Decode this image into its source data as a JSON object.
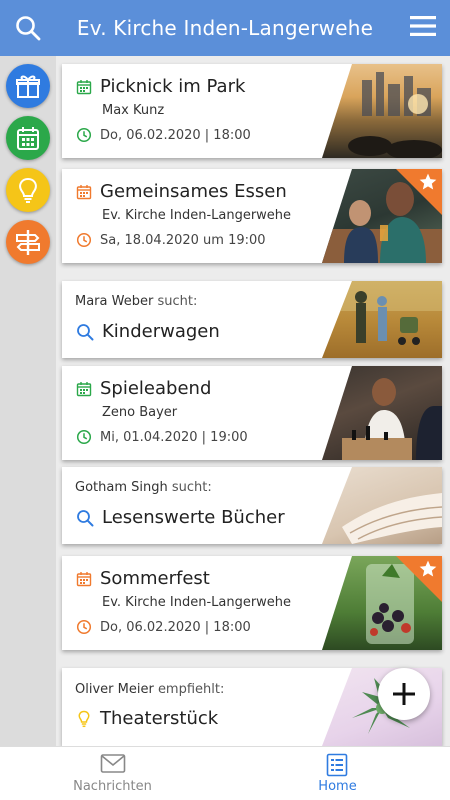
{
  "header": {
    "title": "Ev. Kirche Inden-Langerwehe",
    "search_icon": "search-icon",
    "menu_icon": "hamburger-menu-icon",
    "color": "#5b8fd9"
  },
  "rail": {
    "items": [
      {
        "icon": "gift-icon",
        "color": "#2f7be0"
      },
      {
        "icon": "calendar-icon",
        "color": "#2ba84a"
      },
      {
        "icon": "lightbulb-icon",
        "color": "#f5c518"
      },
      {
        "icon": "signpost-icon",
        "color": "#f07a2e"
      }
    ]
  },
  "feed": [
    {
      "type": "event",
      "title": "Picknick im Park",
      "subtitle": "Max Kunz",
      "datetime": "Do, 06.02.2020 | 18:00",
      "accent": "#2ba84a",
      "starred": false
    },
    {
      "type": "event",
      "title": "Gemeinsames Essen",
      "subtitle": "Ev. Kirche Inden-Langerwehe",
      "datetime": "Sa, 18.04.2020 um 19:00",
      "accent": "#f07a2e",
      "starred": true
    },
    {
      "type": "search",
      "person": "Mara Weber",
      "verb": "sucht:",
      "item": "Kinderwagen",
      "accent": "#2f7be0"
    },
    {
      "type": "event",
      "title": "Spieleabend",
      "subtitle": "Zeno Bayer",
      "datetime": "Mi, 01.04.2020 | 19:00",
      "accent": "#2ba84a",
      "starred": false
    },
    {
      "type": "search",
      "person": "Gotham Singh",
      "verb": "sucht:",
      "item": "Lesenswerte Bücher",
      "accent": "#2f7be0"
    },
    {
      "type": "event",
      "title": "Sommerfest",
      "subtitle": "Ev. Kirche Inden-Langerwehe",
      "datetime": "Do, 06.02.2020 | 18:00",
      "accent": "#f07a2e",
      "starred": true
    },
    {
      "type": "recommend",
      "person": "Oliver Meier",
      "verb": "empfiehlt:",
      "item": "Theaterstück",
      "accent": "#f5c518"
    }
  ],
  "fab": {
    "icon": "plus-icon"
  },
  "bottom_nav": {
    "items": [
      {
        "label": "Nachrichten",
        "icon": "envelope-icon",
        "active": false
      },
      {
        "label": "Home",
        "icon": "home-list-icon",
        "active": true
      }
    ],
    "active_color": "#2f7be0",
    "inactive_color": "#888888"
  }
}
